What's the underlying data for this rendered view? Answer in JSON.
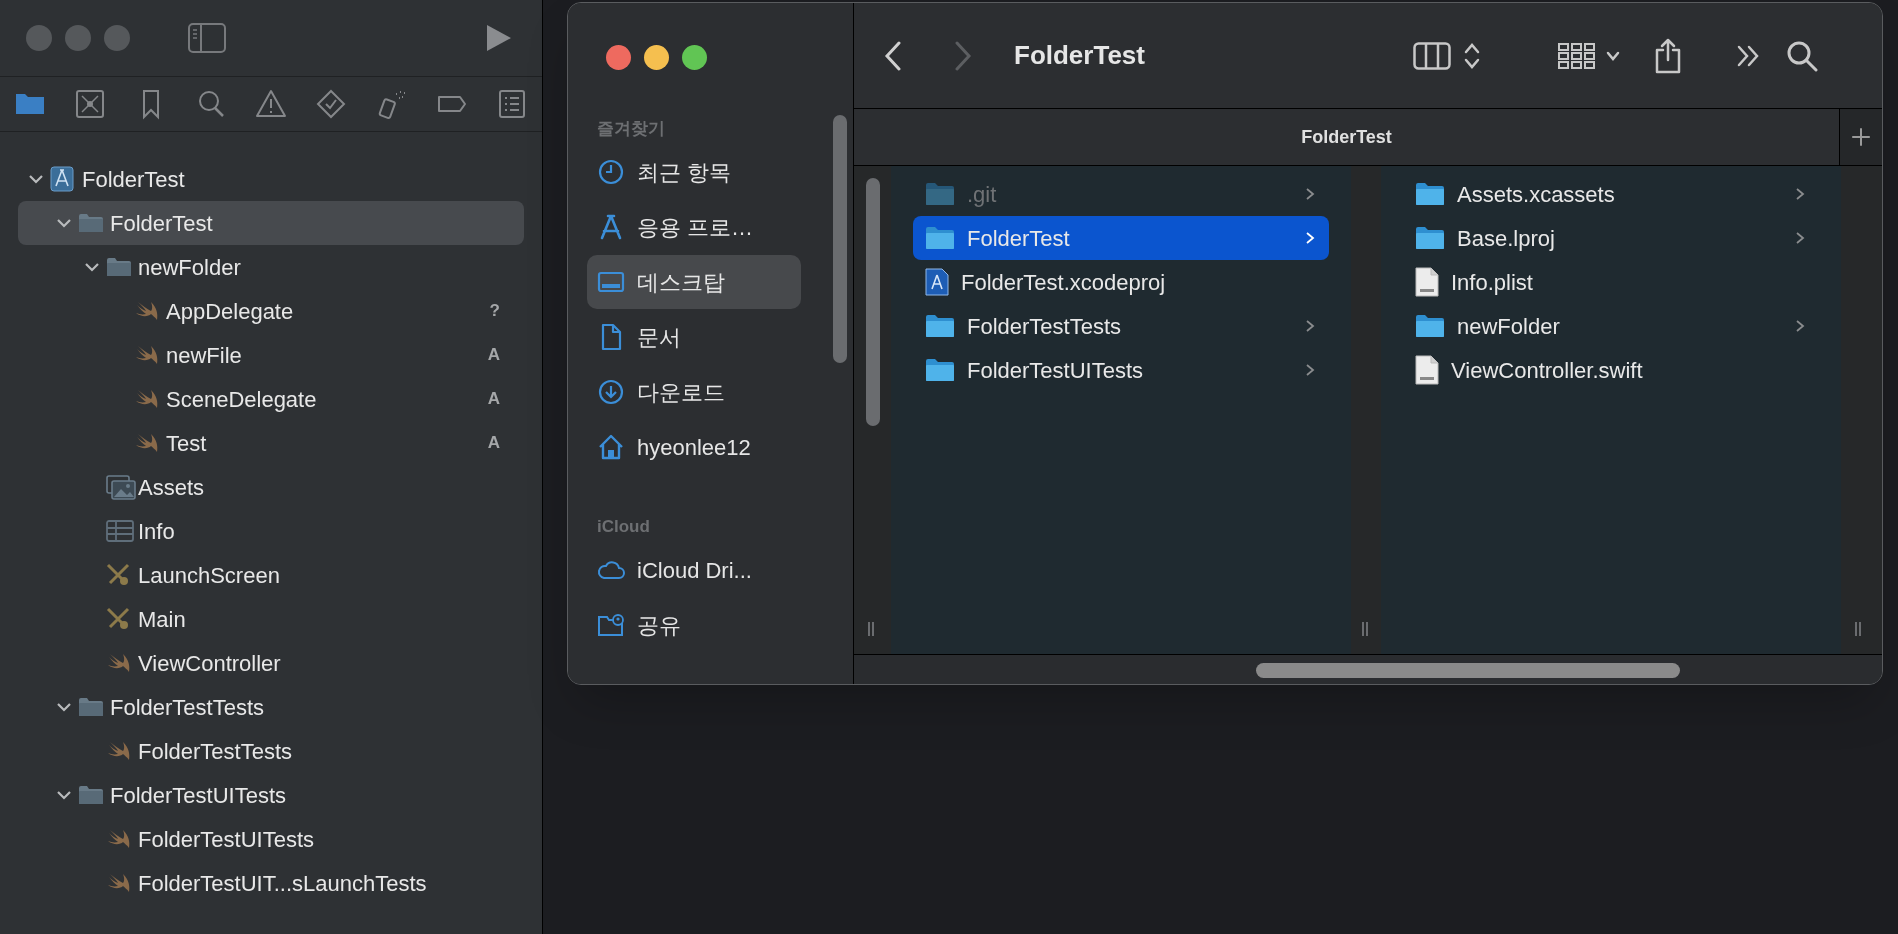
{
  "xcode": {
    "navigator_tabs": [
      {
        "kind": "folder",
        "selected": true
      },
      {
        "kind": "source-control",
        "selected": false
      },
      {
        "kind": "bookmark",
        "selected": false
      },
      {
        "kind": "search",
        "selected": false
      },
      {
        "kind": "warning",
        "selected": false
      },
      {
        "kind": "test",
        "selected": false
      },
      {
        "kind": "debug",
        "selected": false
      },
      {
        "kind": "breakpoint",
        "selected": false
      },
      {
        "kind": "report",
        "selected": false
      }
    ],
    "tree": [
      {
        "label": "FolderTest",
        "kind": "project",
        "expanded": true,
        "selected": false,
        "children": [
          {
            "label": "FolderTest",
            "kind": "folder",
            "expanded": true,
            "selected": true,
            "children": [
              {
                "label": "newFolder",
                "kind": "folder",
                "expanded": true,
                "selected": false,
                "children": [
                  {
                    "label": "AppDelegate",
                    "kind": "swift",
                    "selected": false,
                    "status": "?"
                  },
                  {
                    "label": "newFile",
                    "kind": "swift",
                    "selected": false,
                    "status": "A"
                  },
                  {
                    "label": "SceneDelegate",
                    "kind": "swift",
                    "selected": false,
                    "status": "A"
                  },
                  {
                    "label": "Test",
                    "kind": "swift",
                    "selected": false,
                    "status": "A"
                  }
                ]
              },
              {
                "label": "Assets",
                "kind": "assets",
                "selected": false
              },
              {
                "label": "Info",
                "kind": "plist",
                "selected": false
              },
              {
                "label": "LaunchScreen",
                "kind": "storyboard",
                "selected": false
              },
              {
                "label": "Main",
                "kind": "storyboard",
                "selected": false
              },
              {
                "label": "ViewController",
                "kind": "swift",
                "selected": false
              }
            ]
          },
          {
            "label": "FolderTestTests",
            "kind": "folder",
            "expanded": true,
            "selected": false,
            "children": [
              {
                "label": "FolderTestTests",
                "kind": "swift",
                "selected": false
              }
            ]
          },
          {
            "label": "FolderTestUITests",
            "kind": "folder",
            "expanded": true,
            "selected": false,
            "children": [
              {
                "label": "FolderTestUITests",
                "kind": "swift",
                "selected": false
              },
              {
                "label": "FolderTestUIT...sLaunchTests",
                "kind": "swift",
                "selected": false
              }
            ]
          }
        ]
      }
    ]
  },
  "finder": {
    "title": "FolderTest",
    "tab": "FolderTest",
    "sidebar": [
      {
        "heading": "즐겨찾기",
        "items": [
          {
            "label": "최근 항목",
            "kind": "clock",
            "selected": false
          },
          {
            "label": "응용 프로…",
            "kind": "apps",
            "selected": false
          },
          {
            "label": "데스크탑",
            "kind": "desktop",
            "selected": true
          },
          {
            "label": "문서",
            "kind": "document",
            "selected": false
          },
          {
            "label": "다운로드",
            "kind": "download",
            "selected": false
          },
          {
            "label": "hyeonlee12",
            "kind": "home",
            "selected": false
          }
        ]
      },
      {
        "heading": "iCloud",
        "items": [
          {
            "label": "iCloud Dri...",
            "kind": "cloud",
            "selected": false
          },
          {
            "label": "공유",
            "kind": "shared",
            "selected": false
          }
        ]
      }
    ],
    "columns": [
      [
        {
          "label": ".git",
          "kind": "folder",
          "selected": false,
          "hidden": true,
          "arrow": true
        },
        {
          "label": "FolderTest",
          "kind": "folder",
          "selected": true,
          "hidden": false,
          "arrow": true
        },
        {
          "label": "FolderTest.xcodeproj",
          "kind": "xcodeproj",
          "selected": false,
          "hidden": false,
          "arrow": false
        },
        {
          "label": "FolderTestTests",
          "kind": "folder",
          "selected": false,
          "hidden": false,
          "arrow": true
        },
        {
          "label": "FolderTestUITests",
          "kind": "folder",
          "selected": false,
          "hidden": false,
          "arrow": true
        }
      ],
      [
        {
          "label": "Assets.xcassets",
          "kind": "folder",
          "selected": false,
          "hidden": false,
          "arrow": true
        },
        {
          "label": "Base.lproj",
          "kind": "folder",
          "selected": false,
          "hidden": false,
          "arrow": true
        },
        {
          "label": "Info.plist",
          "kind": "file",
          "selected": false,
          "hidden": false,
          "arrow": false
        },
        {
          "label": "newFolder",
          "kind": "folder",
          "selected": false,
          "hidden": false,
          "arrow": true
        },
        {
          "label": "ViewController.swift",
          "kind": "file",
          "selected": false,
          "hidden": false,
          "arrow": false
        }
      ]
    ]
  }
}
